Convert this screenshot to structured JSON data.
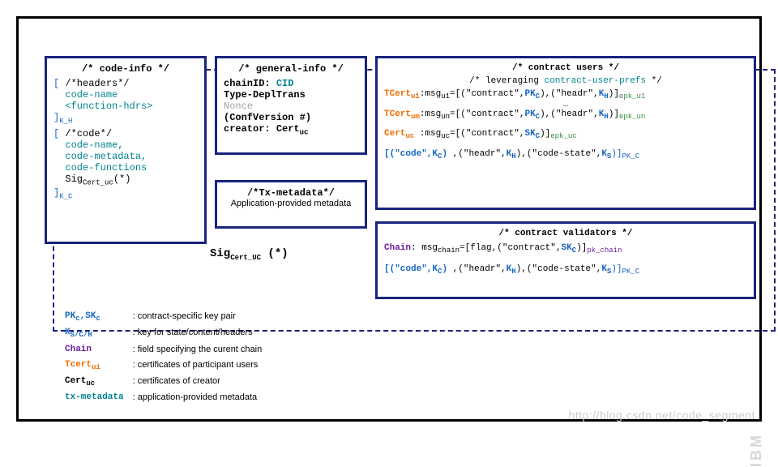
{
  "sig_label": "Sig",
  "sig_sub": "Cert_UC",
  "sig_star": " (*)",
  "codeInfo": {
    "title": "/* code-info */",
    "h_open": "[",
    "h_comment": " /*headers*/",
    "h_line1": "code-name",
    "h_line2": "<function-hdrs>",
    "h_close": "]",
    "h_sub": "K_H",
    "c_open": "[",
    "c_comment": " /*code*/",
    "c_line1": "code-name,",
    "c_line2": "code-metadata,",
    "c_line3": "code-functions",
    "c_line4a": "Sig",
    "c_line4b": "Cert_uc",
    "c_line4c": "(*)",
    "c_close": "]",
    "c_sub": "K_C"
  },
  "generalInfo": {
    "title": "/* general-info */",
    "l1a": "chainID: ",
    "l1b": "CID",
    "l2": "Type-DeplTrans",
    "l3": "Nonce",
    "l4": "(ConfVersion #)",
    "l5a": "creator: ",
    "l5b": "Cert",
    "l5c": "uc"
  },
  "txMeta": {
    "title": "/*Tx-metadata*/",
    "line": "Application-provided metadata"
  },
  "users": {
    "title": "/* contract users */",
    "subtitle_a": "/* leveraging ",
    "subtitle_b": "contract-user-prefs",
    "subtitle_c": " */",
    "r1a": "TCert",
    "r1b": "u1",
    "r1c": ":msg",
    "r1d": "u1",
    "r1e": "=[(\"contract\",",
    "r1f": "PK",
    "r1g": "C",
    "r1h": "),(\"headr\",",
    "r1i": "K",
    "r1j": "H",
    "r1k": ")]",
    "r1l": "epk_u1",
    "dots": "…",
    "r2a": "TCert",
    "r2b": "um",
    "r2c": ":msg",
    "r2d": "un",
    "r2e": "=[(\"contract\",",
    "r2f": "PK",
    "r2g": "C",
    "r2h": "),(\"headr\",",
    "r2i": "K",
    "r2j": "H",
    "r2k": ")]",
    "r2l": "epk_un",
    "r3a": "Cert",
    "r3b": "uc",
    "r3c": " :msg",
    "r3d": "uc",
    "r3e": "=[(\"contract\",",
    "r3f": "SK",
    "r3g": "C",
    "r3h": ")]",
    "r3i": "epk_uc",
    "r4a": "[(\"code\",",
    "r4b": "K",
    "r4c": "C",
    "r4d": ")",
    "r4e": " ,(\"headr\",",
    "r4f": "K",
    "r4g": "H",
    "r4h": "),(\"code-state\",",
    "r4i": "K",
    "r4j": "S",
    "r4k": ")]",
    "r4l": "PK_C"
  },
  "validators": {
    "title": "/* contract validators */",
    "r1a": "Chain",
    "r1b": ": msg",
    "r1c": "chain",
    "r1d": "=[flag,(\"contract\",",
    "r1e": "SK",
    "r1f": "C",
    "r1g": ")]",
    "r1h": "pk_chain",
    "r2a": "[(\"code\",",
    "r2b": "K",
    "r2c": "C",
    "r2d": ")",
    "r2e": " ,(\"headr\",",
    "r2f": "K",
    "r2g": "H",
    "r2h": "),(\"code-state\",",
    "r2i": "K",
    "r2j": "S",
    "r2k": ")]",
    "r2l": "PK_C"
  },
  "legend": {
    "k1a": "PK",
    "k1b": "c",
    "k1c": ",SK",
    "k1d": "c",
    "d1": ": contract-specific key pair",
    "k2a": "K",
    "k2b": "S/C/H",
    "d2": ": key for state/content/headers",
    "k3": "Chain",
    "d3": ": field specifying the curent chain",
    "k4a": "Tcert",
    "k4b": "ui",
    "d4": ": certificates of participant users",
    "k5a": "Cert",
    "k5b": "uc",
    "d5": ": certificates of creator",
    "k6": "tx-metadata",
    "d6": ": application-provided metadata"
  },
  "watermark": "http://blog.csdn.net/code_segment",
  "ibm": "IBM"
}
